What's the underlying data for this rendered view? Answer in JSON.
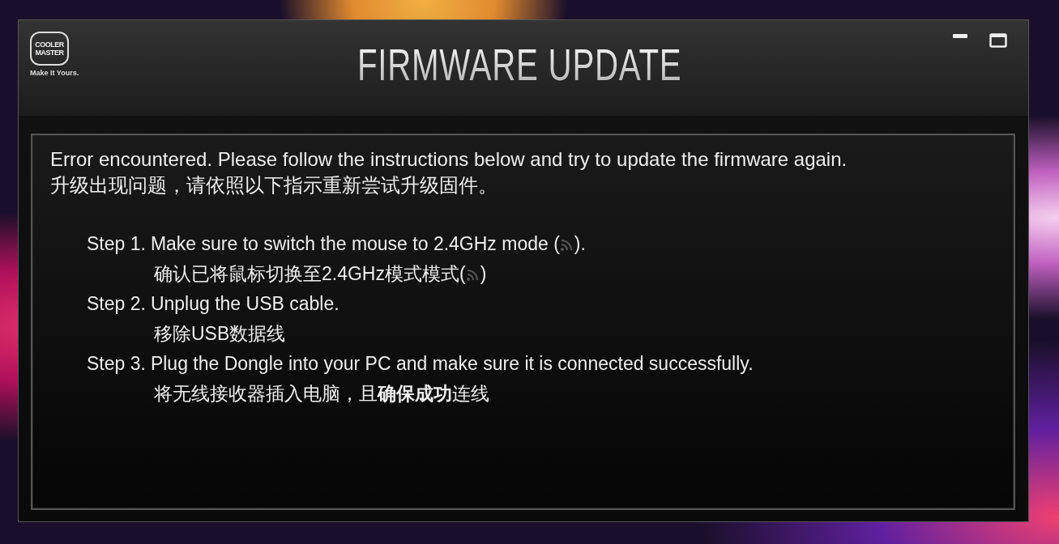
{
  "logo": {
    "lines": [
      "COOLER",
      "MASTER"
    ],
    "tagline": "Make It Yours."
  },
  "window": {
    "title": "FIRMWARE UPDATE"
  },
  "message": {
    "lines": [
      "Error encountered. Please follow the instructions below and try to update the firmware again.",
      "升级出现问题，请依照以下指示重新尝试升级固件。"
    ]
  },
  "steps": [
    {
      "label": "Step 1.",
      "parts": [
        {
          "kind": "text",
          "text": "Make sure to switch the mouse to 2.4GHz mode ("
        },
        {
          "kind": "icon"
        },
        {
          "kind": "text",
          "text": ")."
        }
      ],
      "translation": [
        {
          "kind": "text",
          "text": "确认已将鼠标切换至2.4GHz模式模式("
        },
        {
          "kind": "icon"
        },
        {
          "kind": "text",
          "text": ")"
        }
      ]
    },
    {
      "label": "Step 2.",
      "parts": [
        {
          "kind": "text",
          "text": "Unplug the USB cable."
        }
      ],
      "translation": [
        {
          "kind": "text",
          "text": "移除USB数据线"
        }
      ]
    },
    {
      "label": "Step 3.",
      "parts": [
        {
          "kind": "text",
          "text": "Plug the Dongle into your PC and make sure it is connected successfully."
        }
      ],
      "translation": [
        {
          "kind": "text",
          "text": "将无线接收器插入电脑，且**确保成功**连线"
        }
      ]
    }
  ]
}
